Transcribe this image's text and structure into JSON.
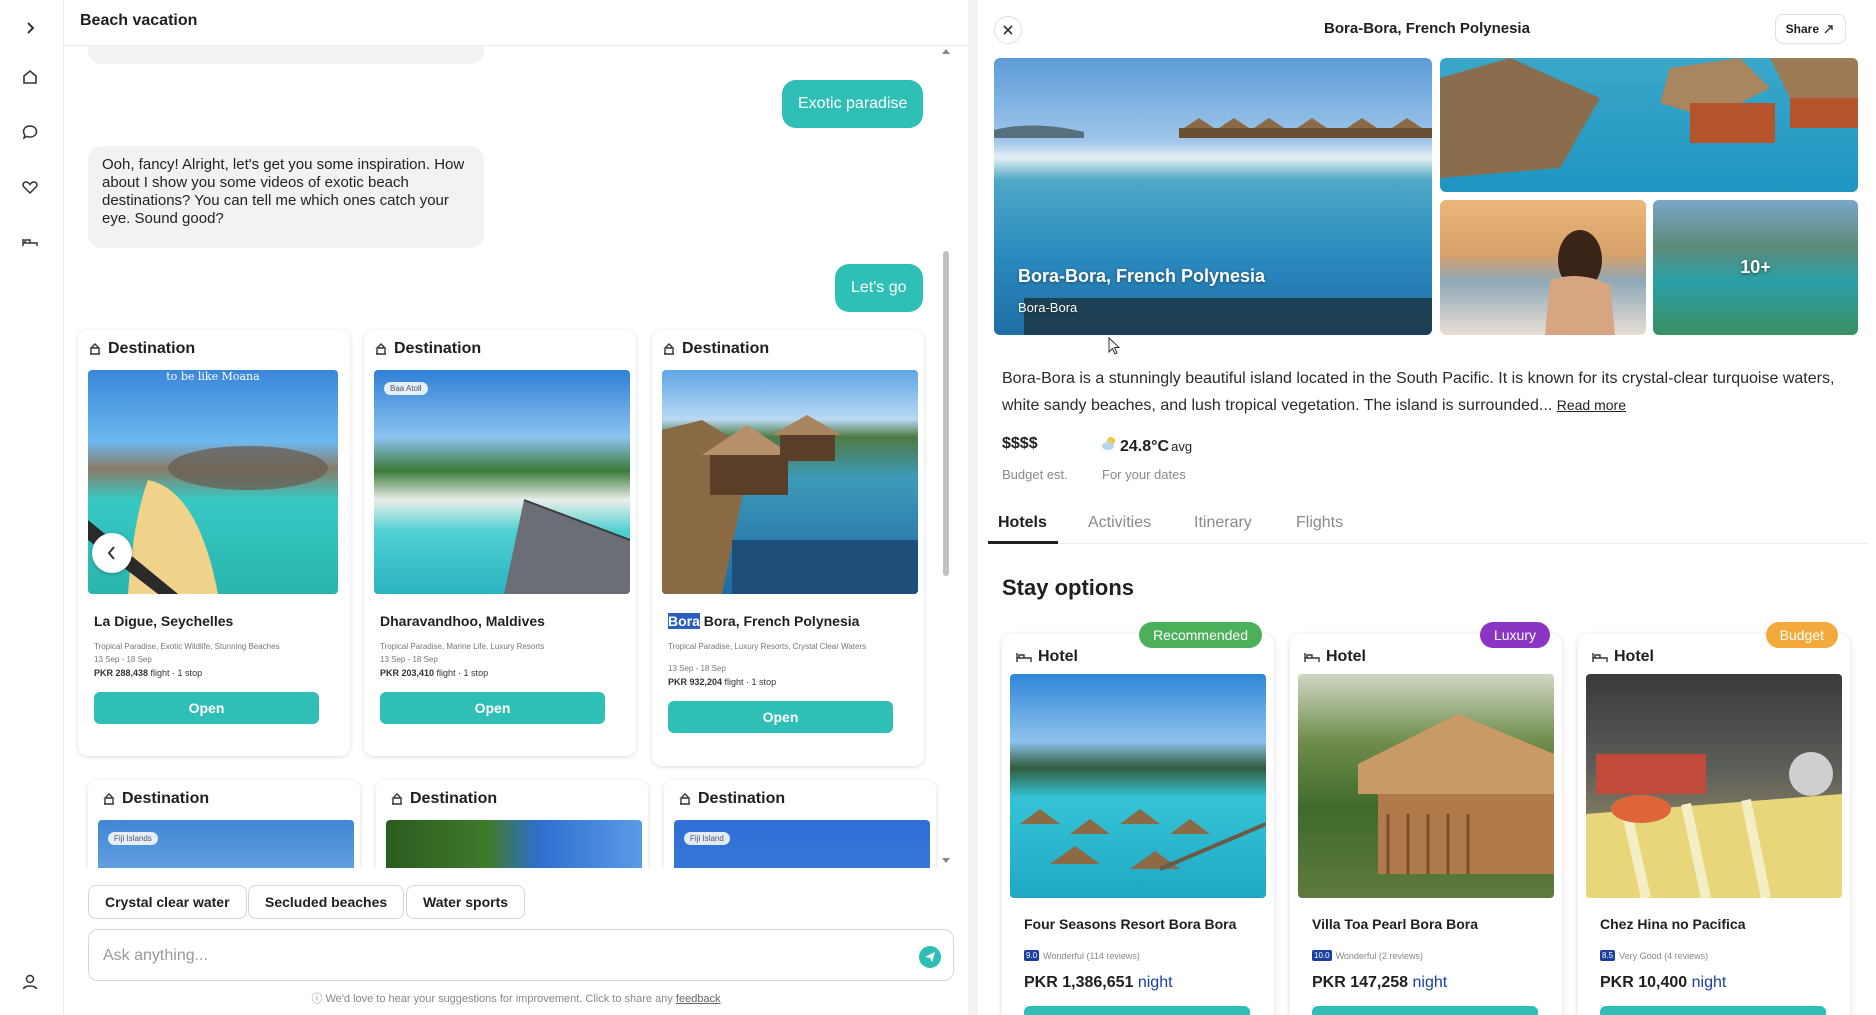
{
  "colors": {
    "accent": "#2fbfb6",
    "recommended": "#4caf5a",
    "luxury": "#8b35c4",
    "budget": "#f4a93c",
    "score": "#1a3fa0"
  },
  "rail": {
    "icons": [
      "chevron-right-icon",
      "home-icon",
      "chat-icon",
      "heart-icon",
      "bed-icon",
      "user-icon"
    ]
  },
  "chat": {
    "title": "Beach vacation",
    "messages": {
      "user1": "Exotic paradise",
      "ai1": "Ooh, fancy! Alright, let's get you some inspiration. How about I show you some videos of exotic beach destinations? You can tell me which ones catch your eye. Sound good?",
      "user2": "Let's go"
    },
    "cards": [
      {
        "type": "Destination",
        "overlay": "to be like Moana",
        "name": "La Digue, Seychelles",
        "tags": "Tropical Paradise, Exotic Wildlife, Stunning Beaches",
        "dates": "13 Sep - 18 Sep",
        "price": "PKR 288,438",
        "price_suffix": " flight · 1 stop",
        "button": "Open"
      },
      {
        "type": "Destination",
        "overlay": "Baa Atoll",
        "name": "Dharavandhoo, Maldives",
        "tags": "Tropical Paradise, Marine Life, Luxury Resorts",
        "dates": "13 Sep - 18 Sep",
        "price": "PKR 203,410",
        "price_suffix": " flight · 1 stop",
        "button": "Open"
      },
      {
        "type": "Destination",
        "name_highlight": "Bora",
        "name_rest": " Bora, French Polynesia",
        "tags": "Tropical Paradise, Luxury Resorts, Crystal Clear Waters",
        "dates": "13 Sep - 18 Sep",
        "price": "PKR 932,204",
        "price_suffix": " flight · 1 stop",
        "button": "Open"
      }
    ],
    "cards_row2": [
      {
        "type": "Destination",
        "overlay": "Fiji Islands"
      },
      {
        "type": "Destination"
      },
      {
        "type": "Destination",
        "overlay": "Fiji Island"
      }
    ],
    "chips": [
      "Crystal clear water",
      "Secluded beaches",
      "Water sports"
    ],
    "input_placeholder": "Ask anything...",
    "feedback_text": "We'd love to hear your suggestions for improvement. Click to share any ",
    "feedback_link": "feedback"
  },
  "detail": {
    "title": "Bora-Bora, French Polynesia",
    "share": "Share",
    "hero_title": "Bora-Bora, French Polynesia",
    "hero_sub": "Bora-Bora",
    "more_photos": "10+",
    "description": "Bora-Bora is a stunningly beautiful island located in the South Pacific. It is known for its crystal-clear turquoise waters, white sandy beaches, and lush tropical vegetation. The island is surrounded...",
    "read_more": "Read more",
    "budget_value": "$$$$",
    "budget_label": "Budget est.",
    "temp_value": "24.8°C",
    "temp_unit": "avg",
    "temp_label": "For your dates",
    "tabs": [
      "Hotels",
      "Activities",
      "Itinerary",
      "Flights"
    ],
    "active_tab": "Hotels",
    "stay_title": "Stay options",
    "hotels": [
      {
        "badge": "Recommended",
        "type": "Hotel",
        "name": "Four Seasons Resort Bora Bora",
        "score": "9.0",
        "rating": "Wonderful (114 reviews)",
        "price": "PKR 1,386,651",
        "unit": " night"
      },
      {
        "badge": "Luxury",
        "type": "Hotel",
        "name": "Villa Toa Pearl Bora Bora",
        "score": "10.0",
        "rating": "Wonderful (2 reviews)",
        "price": "PKR 147,258",
        "unit": " night"
      },
      {
        "badge": "Budget",
        "type": "Hotel",
        "name": "Chez Hina no Pacifica",
        "score": "8.5",
        "rating": "Very Good (4 reviews)",
        "price": "PKR 10,400",
        "unit": " night"
      }
    ]
  }
}
